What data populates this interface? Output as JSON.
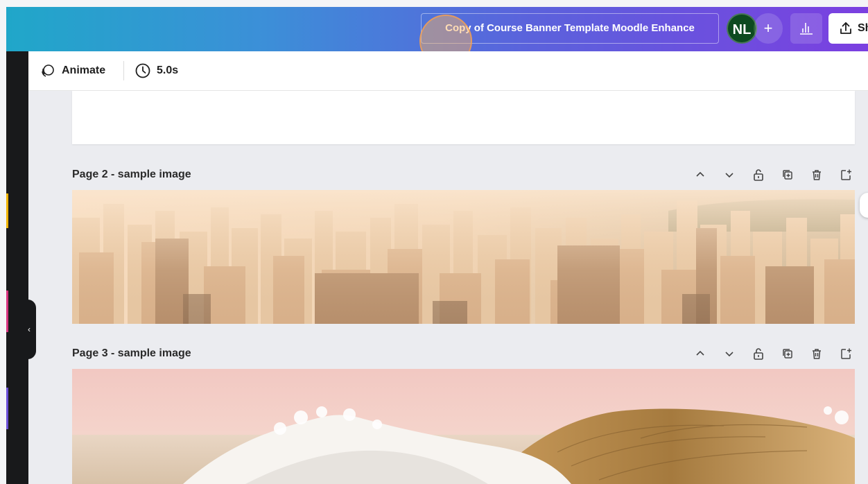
{
  "topbar": {
    "design_title": "Copy of Course Banner Template Moodle Enhance",
    "avatar_initials": "NL",
    "add_label": "+",
    "share_label": "Sh",
    "gradient_colors": [
      "#20a7c9",
      "#5a63dc",
      "#7b3fe0"
    ]
  },
  "toolbar": {
    "animate_label": "Animate",
    "duration_label": "5.0s"
  },
  "pages": [
    {
      "label": "Page 2 - sample image",
      "image": "city-skyline"
    },
    {
      "label": "Page 3 - sample image",
      "image": "ocean-wave"
    }
  ],
  "page_action_icons": [
    "chevron-up-icon",
    "chevron-down-icon",
    "lock-icon",
    "duplicate-icon",
    "trash-icon",
    "add-page-icon"
  ],
  "colors": {
    "canvas_bg": "#ebecf0",
    "left_rail": "#18191b",
    "avatar_bg": "#0d4a20"
  }
}
